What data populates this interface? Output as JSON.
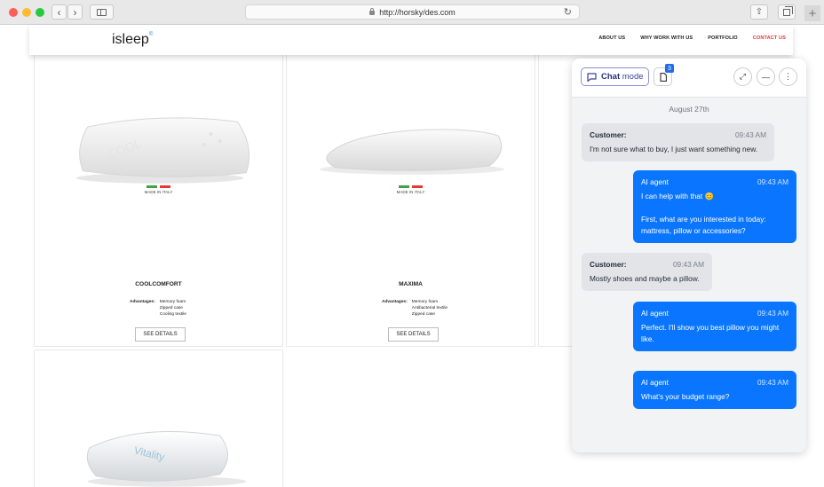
{
  "browser": {
    "url": "http://horsky/des.com",
    "back_glyph": "‹",
    "forward_glyph": "›",
    "reload_glyph": "↻",
    "share_glyph": "⇧",
    "new_tab_glyph": "+"
  },
  "site": {
    "logo": "isleep",
    "logo_mark": "©",
    "nav": [
      "ABOUT US",
      "WHY WORK WITH US",
      "PORTFOLIO",
      "CONTACT US"
    ],
    "accent_color": "#e53935"
  },
  "products": [
    {
      "name": "COOLCOMFORT",
      "made_in": "MADE IN ITALY",
      "advantages_label": "Advantages:",
      "advantages": [
        "Memory foam",
        "Zipped case",
        "Cooling textile"
      ],
      "button": "SEE DETAILS",
      "image_text": "COOL"
    },
    {
      "name": "MAXIMA",
      "made_in": "MADE IN ITALY",
      "advantages_label": "Advantages:",
      "advantages": [
        "Memory foam",
        "Antibacterial textile",
        "Zipped case"
      ],
      "button": "SEE DETAILS"
    },
    {
      "name": "Vitality",
      "image_text": "Vitality"
    }
  ],
  "chat": {
    "mode_label_part1": "Chat",
    "mode_label_part2": " mode",
    "doc_badge": "3",
    "expand_glyph": "⤢",
    "minimize_glyph": "—",
    "more_glyph": "⋮",
    "date": "August 27th",
    "accent_color": "#0a76ff",
    "messages": [
      {
        "sender": "Customer:",
        "time": "09:43 AM",
        "text": "I'm not sure what to buy, I just want something new."
      },
      {
        "sender": "AI agent",
        "time": "09:43 AM",
        "text": "I can help with that 😊\n\nFirst, what are you interested in today: mattress, pillow or accessories?"
      },
      {
        "sender": "Customer:",
        "time": "09:43 AM",
        "text": "Mostly shoes and maybe a pillow."
      },
      {
        "sender": "AI agent",
        "time": "09:43 AM",
        "text": "Perfect. I'll show you best pillow you might like."
      },
      {
        "sender": "AI agent",
        "time": "09:43 AM",
        "text": "What's your budget range?"
      }
    ]
  }
}
